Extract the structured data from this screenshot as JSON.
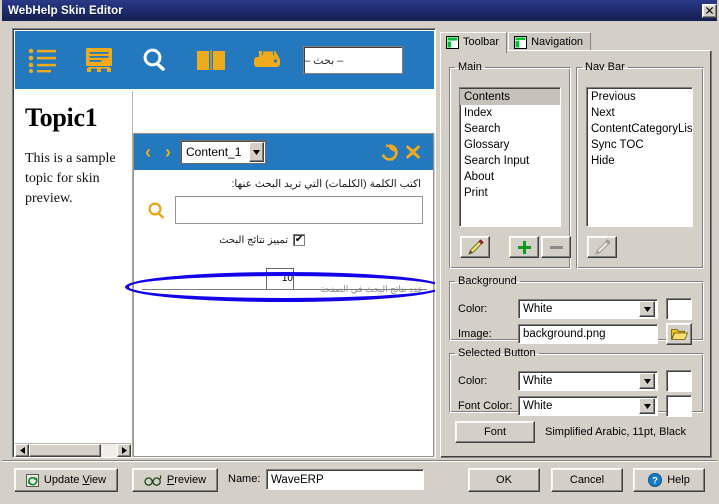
{
  "window": {
    "title": "WebHelp Skin Editor",
    "close_label": "✕"
  },
  "preview": {
    "toolbar_icons": [
      {
        "name": "contents-icon",
        "title": "Contents"
      },
      {
        "name": "index-icon",
        "title": "Index"
      },
      {
        "name": "search-icon",
        "title": "Search"
      },
      {
        "name": "glossary-icon",
        "title": "Glossary"
      },
      {
        "name": "print-icon",
        "title": "Print"
      }
    ],
    "toolbar_search_placeholder": "– بحث –",
    "toolbar_bg_color": "#2478bd",
    "topic_heading": "Topic1",
    "topic_body": "This is a sample topic for skin preview.",
    "content_panel": {
      "prev_arrow": "‹",
      "next_arrow": "›",
      "selected_content": "Content_1",
      "dropdown_arrow": "▼",
      "refresh_label": "refresh",
      "close_label": "✖",
      "search_prompt": "اكتب الكلمة (الكلمات) التي تريد البحث عنها:",
      "search_value": "",
      "highlight_checkbox_label": "تمييز نتائج البحث",
      "highlight_checked": "✔",
      "results_row_text": "عدد نتائج البحث في الصفحة",
      "results_count": "10"
    }
  },
  "settings": {
    "tabs": [
      {
        "label": "Toolbar",
        "icon": "pane-layout-icon",
        "active": true
      },
      {
        "label": "Navigation",
        "icon": "pane-layout-icon",
        "active": false
      }
    ],
    "main_group": {
      "legend": "Main",
      "items": [
        {
          "label": "Contents",
          "selected": true
        },
        {
          "label": "Index",
          "selected": false
        },
        {
          "label": "Search",
          "selected": false
        },
        {
          "label": "Glossary",
          "selected": false
        },
        {
          "label": "Search Input",
          "selected": false
        },
        {
          "label": "About",
          "selected": false
        },
        {
          "label": "Print",
          "selected": false
        }
      ],
      "buttons": [
        {
          "name": "edit-button",
          "icon": "pencil-icon",
          "enabled": true
        },
        {
          "name": "add-button",
          "icon": "plus-icon",
          "enabled": true
        },
        {
          "name": "remove-button",
          "icon": "minus-icon",
          "enabled": false
        }
      ]
    },
    "navbar_group": {
      "legend": "Nav Bar",
      "items": [
        {
          "label": "Previous",
          "selected": false
        },
        {
          "label": "Next",
          "selected": false
        },
        {
          "label": "ContentCategoryList",
          "selected": false
        },
        {
          "label": "Sync TOC",
          "selected": false
        },
        {
          "label": "Hide",
          "selected": false
        }
      ],
      "buttons": [
        {
          "name": "edit-button",
          "icon": "pencil-icon",
          "enabled": false
        }
      ]
    },
    "background_group": {
      "legend": "Background",
      "color_label": "Color:",
      "color_value": "White",
      "color_swatch": "#ffffff",
      "image_label": "Image:",
      "image_value": "background.png",
      "browse_icon": "folder-open-icon"
    },
    "selected_button_group": {
      "legend": "Selected Button",
      "color_label": "Color:",
      "color_value": "White",
      "color_swatch": "#ffffff",
      "font_color_label": "Font Color:",
      "font_color_value": "White",
      "font_color_swatch": "#ffffff"
    },
    "font_row": {
      "button_label": "Font",
      "description": "Simplified Arabic, 11pt, Black"
    }
  },
  "footer": {
    "update_view_label": "Update View",
    "update_view_icon": "refresh-icon",
    "preview_label": "Preview",
    "preview_icon": "glasses-icon",
    "name_label": "Name:",
    "name_value": "WaveERP",
    "ok_label": "OK",
    "cancel_label": "Cancel",
    "help_label": "Help",
    "help_icon": "question-circle-icon"
  }
}
